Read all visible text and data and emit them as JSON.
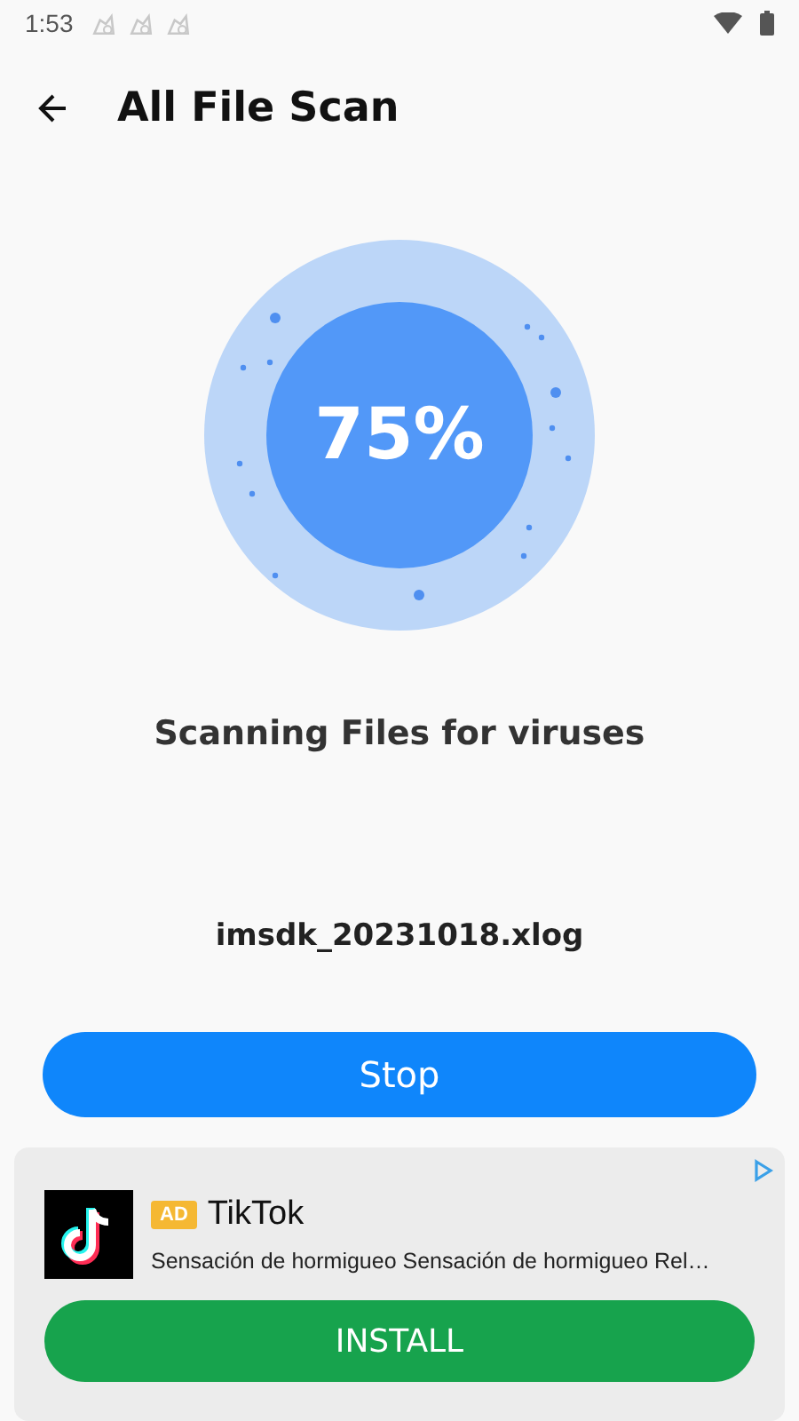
{
  "status_bar": {
    "time": "1:53"
  },
  "header": {
    "title": "All File Scan"
  },
  "scan": {
    "percent": "75%",
    "message": "Scanning Files for viruses",
    "current_file": "imsdk_20231018.xlog"
  },
  "stop_button": {
    "label": "Stop"
  },
  "ad": {
    "badge": "AD",
    "app_name": "TikTok",
    "description": "Sensación de hormigueo Sensación de hormigueo Rel…",
    "install_label": "INSTALL"
  }
}
